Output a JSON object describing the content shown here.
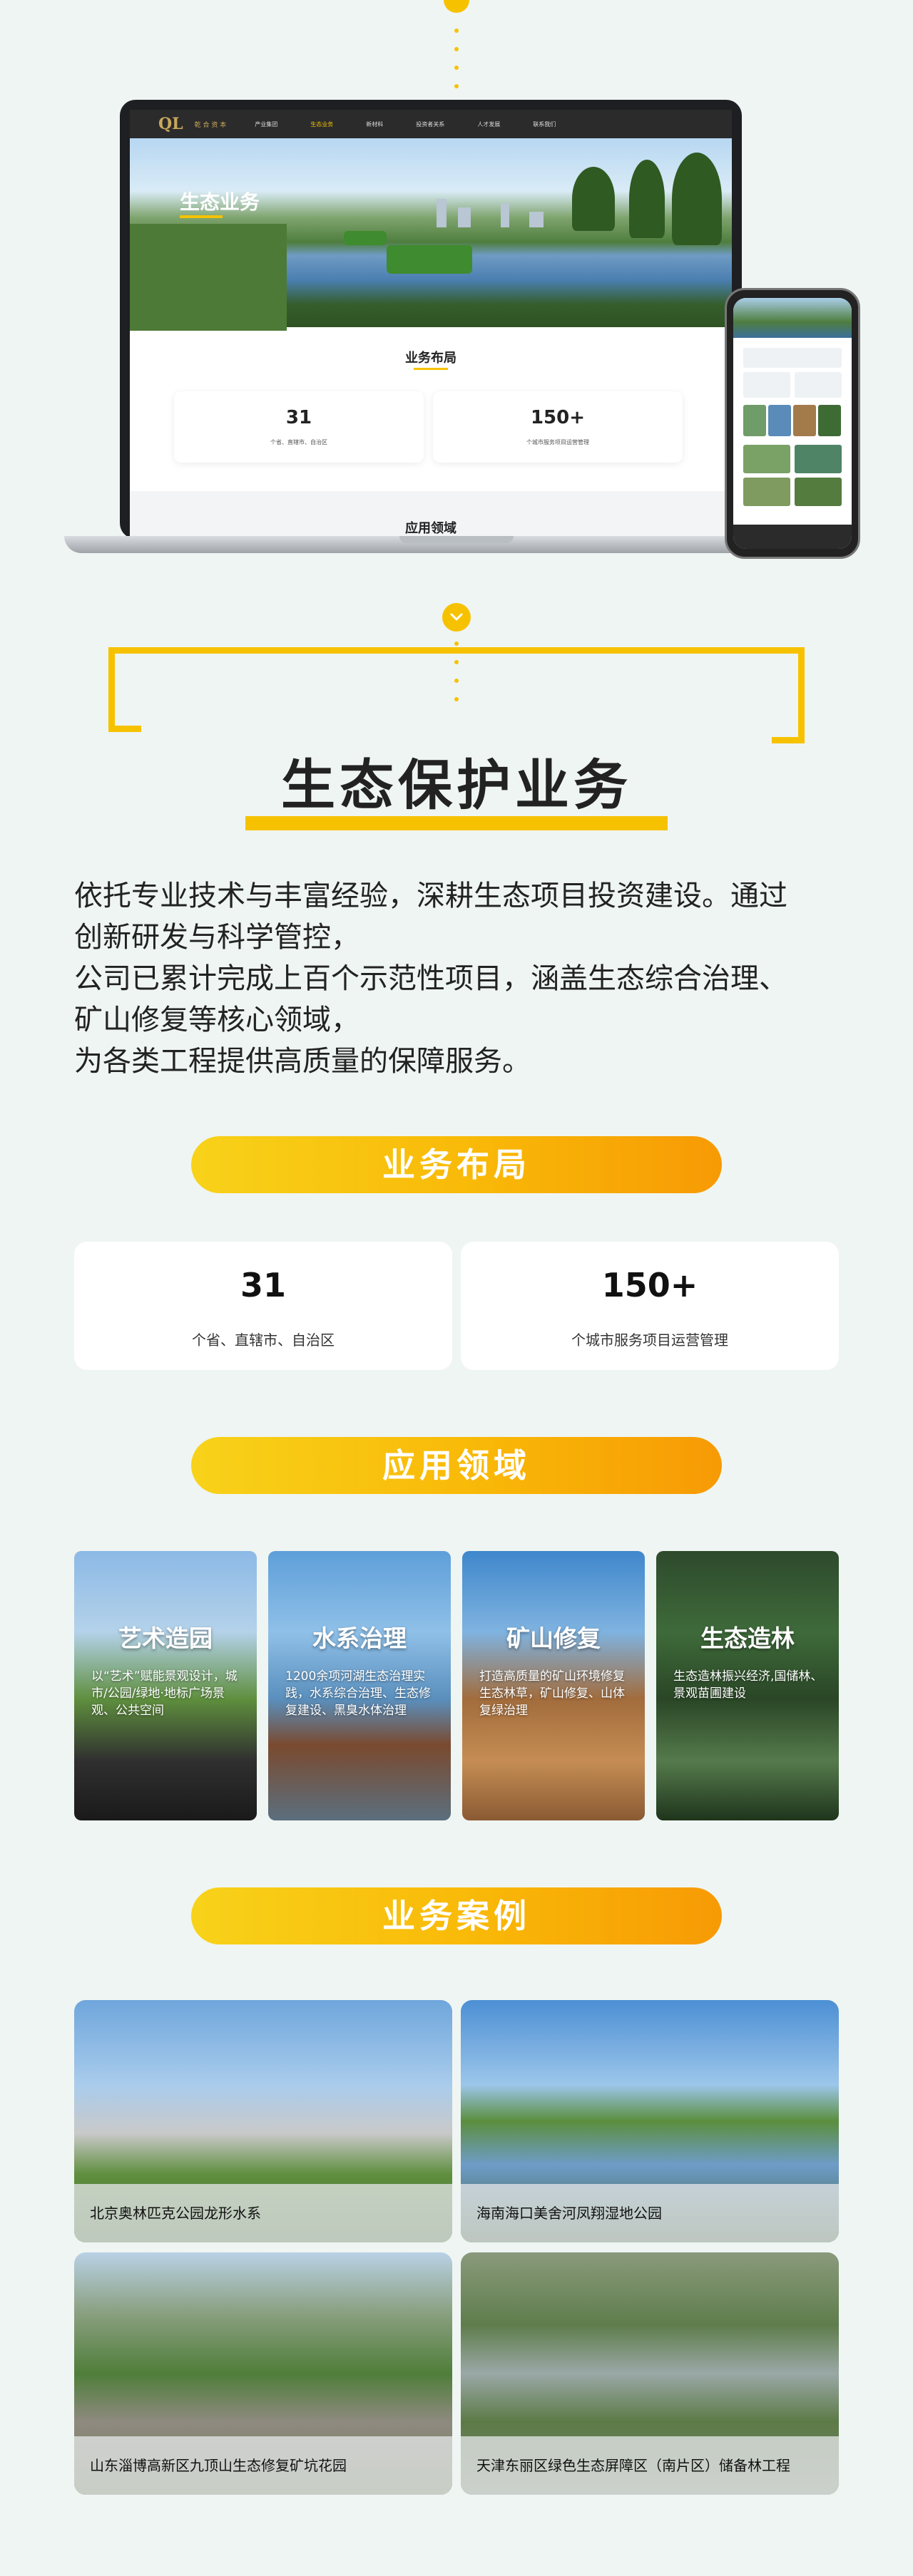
{
  "mockup": {
    "laptop": {
      "logo": "QL",
      "brand": "乾 合 资 本",
      "nav": [
        "产业集团",
        "生态业务",
        "新材料",
        "投资者关系",
        "人才发展",
        "联系我们"
      ],
      "hero_title": "生态业务",
      "section_title": "业务布局",
      "stats": [
        {
          "number": "31",
          "label": "个省、直辖市、自治区"
        },
        {
          "number": "150+",
          "label": "个城市服务项目运营管理"
        }
      ],
      "next_section": "应用领域"
    }
  },
  "header": {
    "title": "生态保护业务"
  },
  "intro": {
    "lines": [
      "依托专业技术与丰富经验，深耕生态项目投资建设。通过",
      "创新研发与科学管控，",
      "公司已累计完成上百个示范性项目，涵盖生态综合治理、",
      "矿山修复等核心领域，",
      "为各类工程提供高质量的保障服务。"
    ]
  },
  "layout_section": {
    "title": "业务布局",
    "stats": [
      {
        "number": "31",
        "label": "个省、直辖市、自治区"
      },
      {
        "number": "150+",
        "label": "个城市服务项目运营管理"
      }
    ]
  },
  "application_section": {
    "title": "应用领域",
    "items": [
      {
        "title": "艺术造园",
        "desc": "以“艺术”赋能景观设计，城市/公园/绿地·地标广场景观、公共空间"
      },
      {
        "title": "水系治理",
        "desc": "1200余项河湖生态治理实践，水系综合治理、生态修复建设、黑臭水体治理"
      },
      {
        "title": "矿山修复",
        "desc": "打造高质量的矿山环境修复生态林草，矿山修复、山体复绿治理"
      },
      {
        "title": "生态造林",
        "desc": "生态造林振兴经济,国储林、景观苗圃建设"
      }
    ]
  },
  "case_section": {
    "title": "业务案例",
    "cases": [
      {
        "caption": "北京奥林匹克公园龙形水系"
      },
      {
        "caption": "海南海口美舍河凤翔湿地公园"
      },
      {
        "caption": "山东淄博高新区九顶山生态修复矿坑花园"
      },
      {
        "caption": "天津东丽区绿色生态屏障区（南片区）储备林工程"
      }
    ]
  },
  "colors": {
    "accent": "#f6c200",
    "pill_start": "#f8d21a",
    "pill_end": "#f79a05",
    "background": "#eff5f2"
  }
}
